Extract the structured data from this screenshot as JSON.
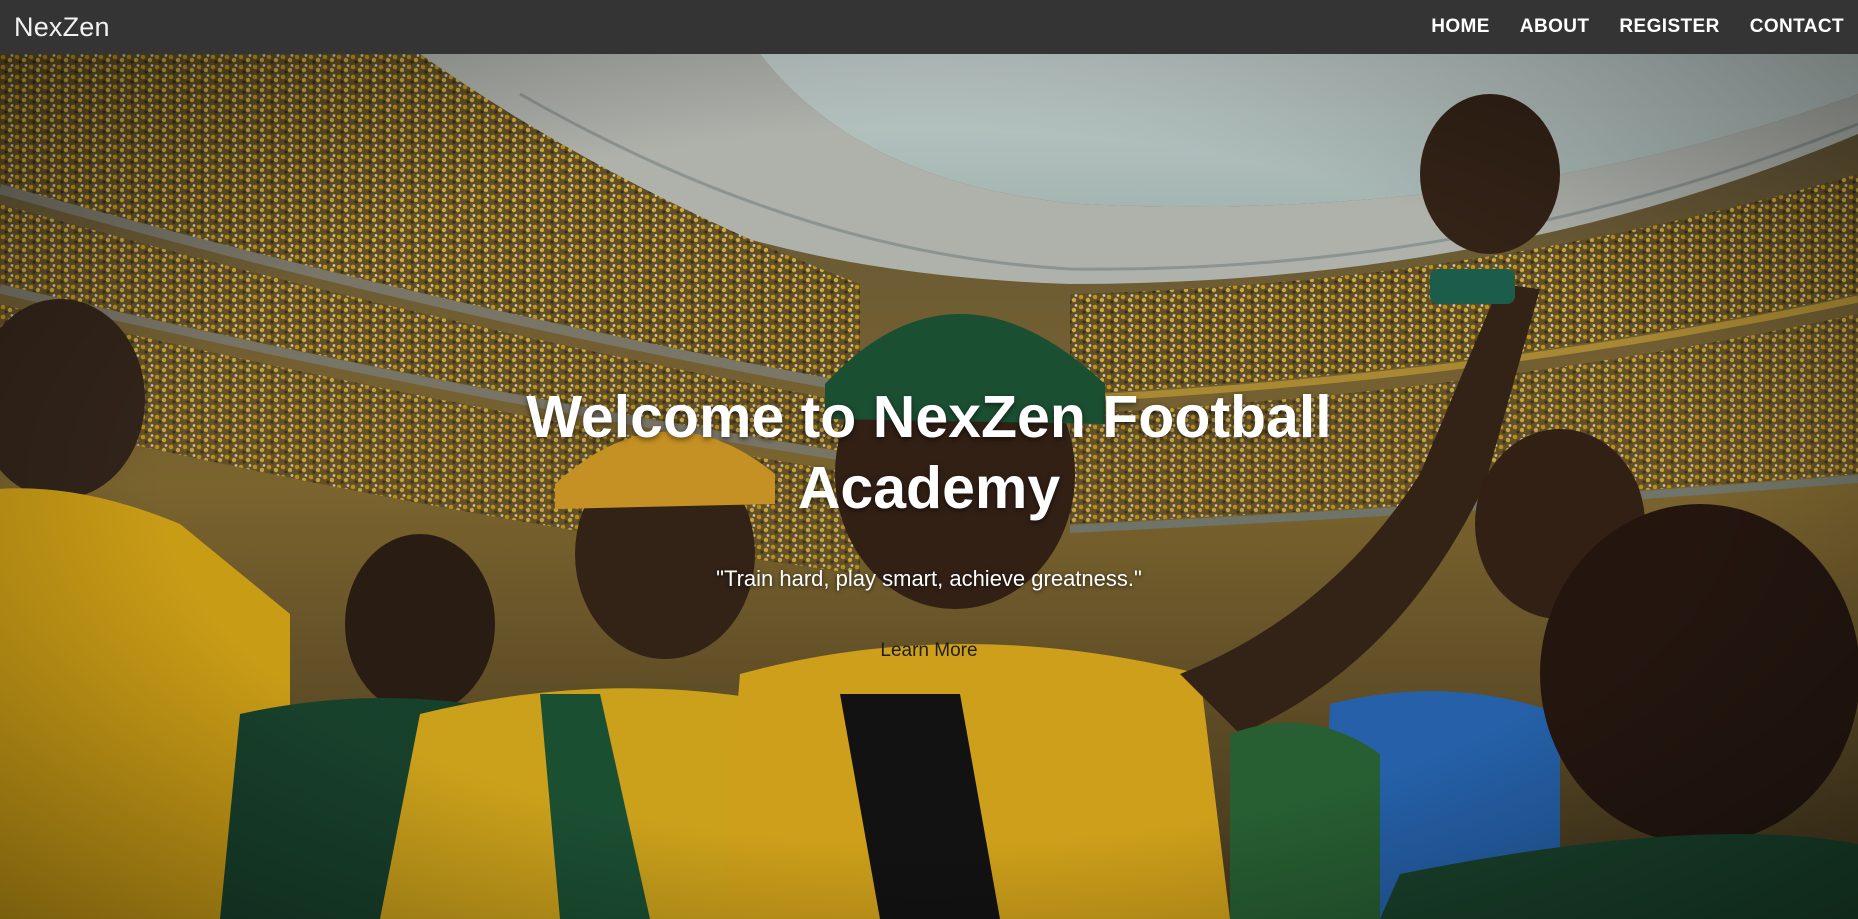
{
  "navbar": {
    "brand": "NexZen",
    "links": [
      {
        "label": "HOME"
      },
      {
        "label": "ABOUT"
      },
      {
        "label": "REGISTER"
      },
      {
        "label": "CONTACT"
      }
    ]
  },
  "hero": {
    "background_description": "stadium crowd of young fans in yellow and green, one raising a fist",
    "title": "Welcome to NexZen Football Academy",
    "quote": "\"Train hard, play smart, achieve greatness.\"",
    "cta_label": "Learn More"
  },
  "colors": {
    "navbar_bg": "#343434",
    "accent_yellow": "#e9b21c",
    "accent_green": "#1f5a3a"
  }
}
